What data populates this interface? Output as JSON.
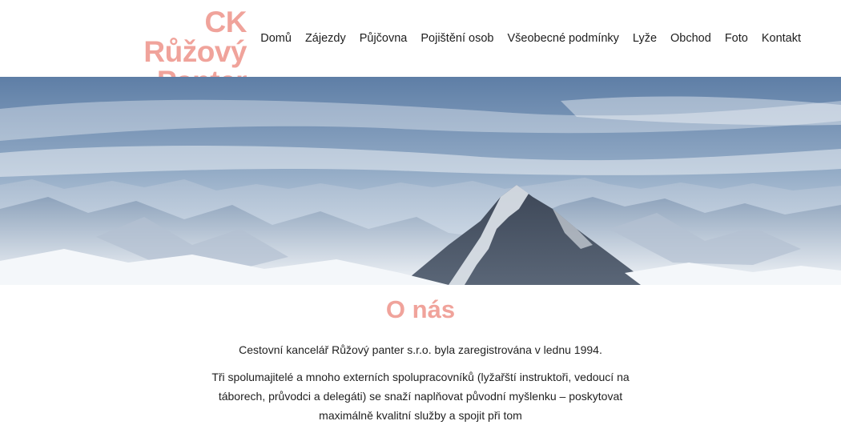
{
  "site": {
    "logo_line1": "CK Růžový",
    "logo_line2": "Panter",
    "brand_color": "#f0a39b"
  },
  "nav": {
    "items": [
      "Domů",
      "Zájezdy",
      "Půjčovna",
      "Pojištění osob",
      "Všeobecné podmínky",
      "Lyže",
      "Obchod",
      "Foto",
      "Kontakt"
    ]
  },
  "hero": {
    "icon": "mountain-panorama-image"
  },
  "about": {
    "title": "O nás",
    "paragraph1": "Cestovní kancelář Růžový panter s.r.o. byla zaregistrována v lednu 1994.",
    "paragraph2": "Tři spolumajitelé a mnoho externích spolupracovníků (lyžařští instruktoři, vedoucí na táborech, průvodci a delegáti) se snaží naplňovat původní myšlenku – poskytovat maximálně kvalitní služby a spojit při tom"
  }
}
